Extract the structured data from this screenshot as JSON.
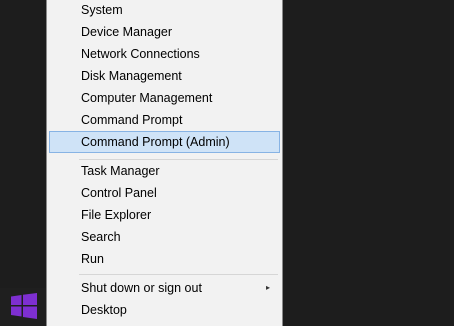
{
  "menu": {
    "group1": [
      {
        "label": "System"
      },
      {
        "label": "Device Manager"
      },
      {
        "label": "Network Connections"
      },
      {
        "label": "Disk Management"
      },
      {
        "label": "Computer Management"
      },
      {
        "label": "Command Prompt"
      },
      {
        "label": "Command Prompt (Admin)",
        "selected": true
      }
    ],
    "group2": [
      {
        "label": "Task Manager"
      },
      {
        "label": "Control Panel"
      },
      {
        "label": "File Explorer"
      },
      {
        "label": "Search"
      },
      {
        "label": "Run"
      }
    ],
    "group3": [
      {
        "label": "Shut down or sign out",
        "submenu_arrow": "▸"
      },
      {
        "label": "Desktop"
      }
    ]
  },
  "colors": {
    "start_logo": "#7e2fd1",
    "selection_bg": "#cfe3f7",
    "selection_border": "#87b3e4",
    "menu_bg": "#f2f2f2"
  },
  "taskbar": {
    "start_icon": "windows-logo-icon"
  }
}
